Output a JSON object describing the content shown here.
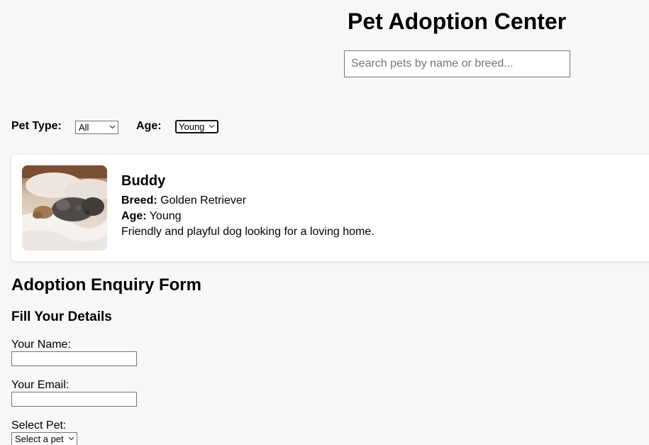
{
  "header": {
    "title": "Pet Adoption Center",
    "search_placeholder": "Search pets by name or breed..."
  },
  "filters": {
    "pet_type_label": "Pet Type:",
    "pet_type_value": "All",
    "age_label": "Age:",
    "age_value": "Young"
  },
  "pets": [
    {
      "name": "Buddy",
      "breed_label": "Breed:",
      "breed": "Golden Retriever",
      "age_label": "Age:",
      "age": "Young",
      "description": "Friendly and playful dog looking for a loving home.",
      "photo_icon": "sleeping-dog-photo"
    }
  ],
  "form": {
    "title": "Adoption Enquiry Form",
    "subtitle": "Fill Your Details",
    "name_label": "Your Name:",
    "name_value": "",
    "email_label": "Your Email:",
    "email_value": "",
    "pet_label": "Select Pet:",
    "pet_value": "Select a pet"
  },
  "icons": {
    "dropdown": "chevron-down-icon"
  },
  "colors": {
    "background": "#f7f7f7",
    "card": "#ffffff",
    "border": "#767676"
  }
}
